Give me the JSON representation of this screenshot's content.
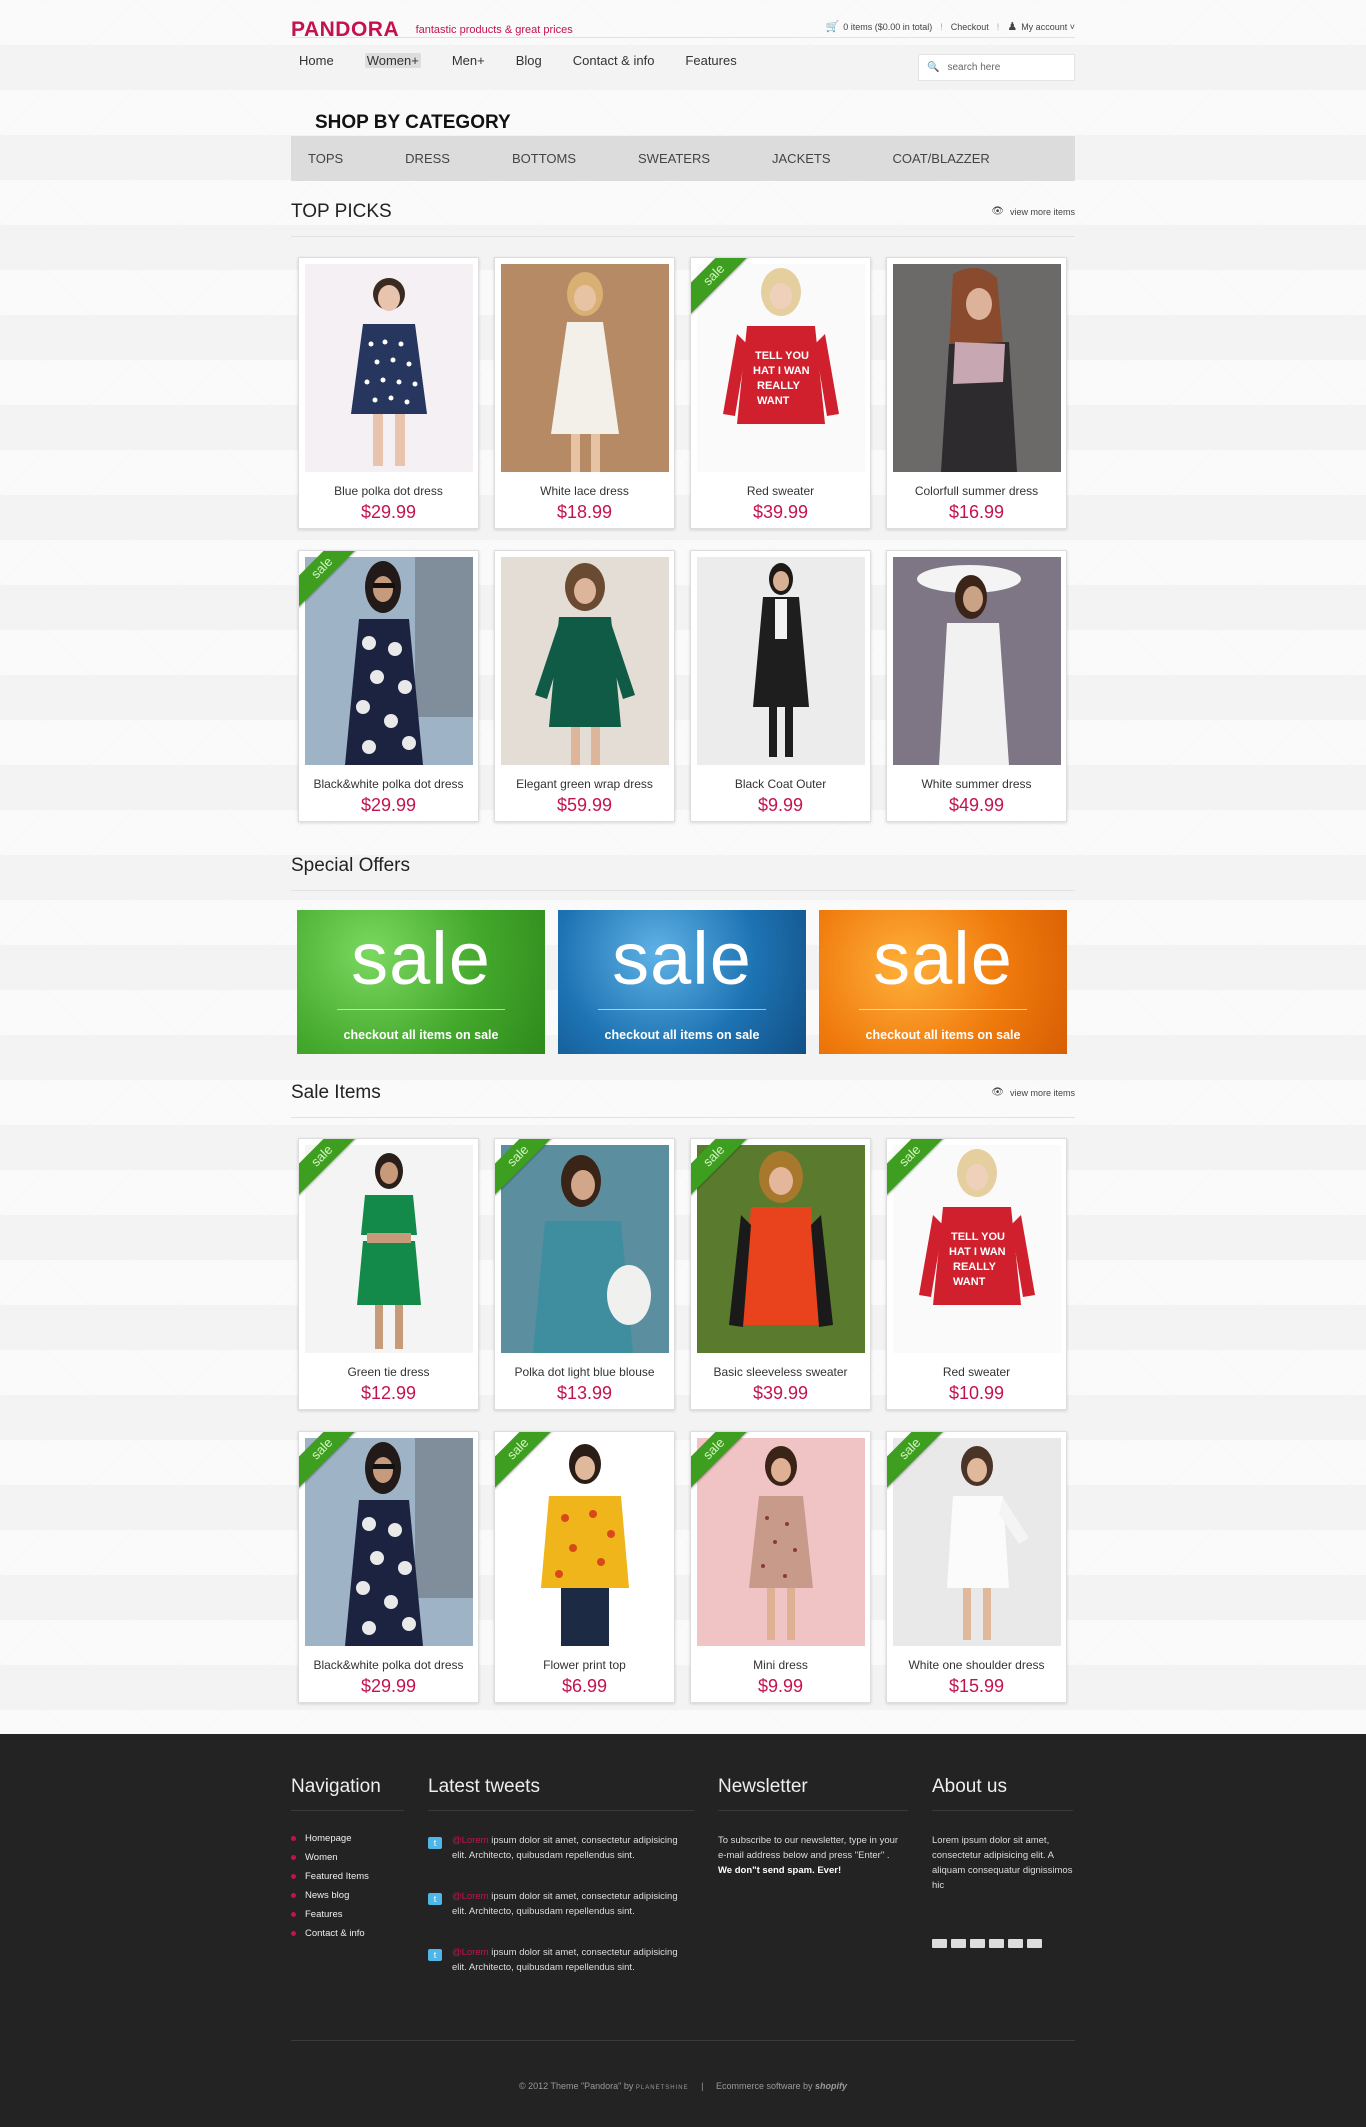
{
  "header": {
    "logo": "PANDORA",
    "tagline": "fantastic products & great prices",
    "cart_text": "0 items ($0.00 in total)",
    "checkout": "Checkout",
    "account": "My account",
    "search_placeholder": "search here"
  },
  "nav": [
    "Home",
    "Women+",
    "Men+",
    "Blog",
    "Contact & info",
    "Features"
  ],
  "category": {
    "title": "SHOP BY CATEGORY",
    "items": [
      "TOPS",
      "DRESS",
      "BOTTOMS",
      "SWEATERS",
      "JACKETS",
      "COAT/BLAZZER"
    ]
  },
  "top_picks": {
    "title": "TOP PICKS",
    "view_more": "view more items",
    "items": [
      {
        "name": "Blue polka dot dress",
        "price": "$29.99",
        "sale": false
      },
      {
        "name": "White lace dress",
        "price": "$18.99",
        "sale": false
      },
      {
        "name": "Red sweater",
        "price": "$39.99",
        "sale": true
      },
      {
        "name": "Colorfull summer dress",
        "price": "$16.99",
        "sale": false
      },
      {
        "name": "Black&white polka dot dress",
        "price": "$29.99",
        "sale": true
      },
      {
        "name": "Elegant green wrap dress",
        "price": "$59.99",
        "sale": false
      },
      {
        "name": "Black Coat Outer",
        "price": "$9.99",
        "sale": false
      },
      {
        "name": "White summer dress",
        "price": "$49.99",
        "sale": false
      }
    ]
  },
  "special_offers": {
    "title": "Special Offers",
    "banners": [
      {
        "big": "sale",
        "caption": "checkout all items on sale"
      },
      {
        "big": "sale",
        "caption": "checkout all items on sale"
      },
      {
        "big": "sale",
        "caption": "checkout all items on sale"
      }
    ]
  },
  "sale_items": {
    "title": "Sale Items",
    "view_more": "view more items",
    "ribbon": "sale",
    "items": [
      {
        "name": "Green tie dress",
        "price": "$12.99"
      },
      {
        "name": "Polka dot light blue blouse",
        "price": "$13.99"
      },
      {
        "name": "Basic sleeveless sweater",
        "price": "$39.99"
      },
      {
        "name": "Red sweater",
        "price": "$10.99"
      },
      {
        "name": "Black&white polka dot dress",
        "price": "$29.99"
      },
      {
        "name": "Flower print top",
        "price": "$6.99"
      },
      {
        "name": "Mini dress",
        "price": "$9.99"
      },
      {
        "name": "White one shoulder dress",
        "price": "$15.99"
      }
    ]
  },
  "footer": {
    "navigation": {
      "title": "Navigation",
      "links": [
        "Homepage",
        "Women",
        "Featured Items",
        "News blog",
        "Features",
        "Contact & info"
      ]
    },
    "tweets": {
      "title": "Latest tweets",
      "items": [
        {
          "user": "@Lorem",
          "text": " ipsum dolor sit amet, consectetur adipisicing elit. Architecto, quibusdam repellendus sint."
        },
        {
          "user": "@Lorem",
          "text": " ipsum dolor sit amet, consectetur adipisicing elit. Architecto, quibusdam repellendus sint."
        },
        {
          "user": "@Lorem",
          "text": " ipsum dolor sit amet, consectetur adipisicing elit. Architecto, quibusdam repellendus sint."
        }
      ]
    },
    "newsletter": {
      "title": "Newsletter",
      "text": "To subscribe to our newsletter, type in your e-mail address below and press \"Enter\" .",
      "bold": "We don\"t send spam. Ever!"
    },
    "about": {
      "title": "About us",
      "text": "Lorem ipsum dolor sit amet, consectetur adipisicing elit. A aliquam consequatur dignissimos hic"
    },
    "copyright": "© 2012 Theme \"Pandora\" by",
    "designer": "PLANETSHINE",
    "software": "Ecommerce software by",
    "shopify": "shopify"
  },
  "colors": {
    "brand": "#c4134c",
    "sale_ribbon": "#3e9e1f",
    "footer_bg": "#232323"
  }
}
